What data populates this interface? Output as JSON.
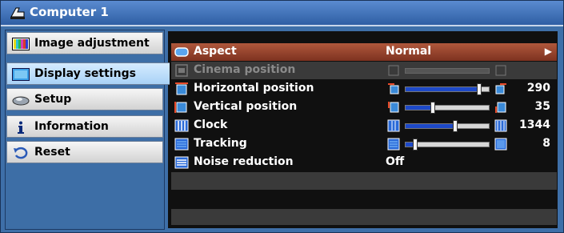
{
  "title": "Computer 1",
  "sidebar": {
    "items": [
      {
        "label": "Image adjustment",
        "icon": "image-adjustment-icon",
        "active": false
      },
      {
        "label": "Display settings",
        "icon": "display-settings-icon",
        "active": true
      },
      {
        "label": "Setup",
        "icon": "setup-icon",
        "active": false
      },
      {
        "label": "Information",
        "icon": "information-icon",
        "active": false
      },
      {
        "label": "Reset",
        "icon": "reset-icon",
        "active": false
      }
    ]
  },
  "main": {
    "rows": [
      {
        "label": "Aspect",
        "value": "Normal",
        "type": "select",
        "icon": "aspect-icon"
      },
      {
        "label": "Cinema position",
        "type": "slider",
        "disabled": true,
        "level": 0,
        "icon": "cinema-position-icon"
      },
      {
        "label": "Horizontal position",
        "type": "slider",
        "value": "290",
        "level": 0.88,
        "icon": "horizontal-position-icon"
      },
      {
        "label": "Vertical position",
        "type": "slider",
        "value": "35",
        "level": 0.33,
        "icon": "vertical-position-icon"
      },
      {
        "label": "Clock",
        "type": "slider",
        "value": "1344",
        "level": 0.6,
        "icon": "clock-icon"
      },
      {
        "label": "Tracking",
        "type": "slider",
        "value": "8",
        "level": 0.12,
        "icon": "tracking-icon"
      },
      {
        "label": "Noise reduction",
        "value": "Off",
        "type": "text",
        "icon": "noise-reduction-icon"
      }
    ]
  },
  "colors": {
    "selected_row": "#b0583c",
    "frame": "#3e6fa8",
    "slider_fill": "#1d49c8"
  }
}
